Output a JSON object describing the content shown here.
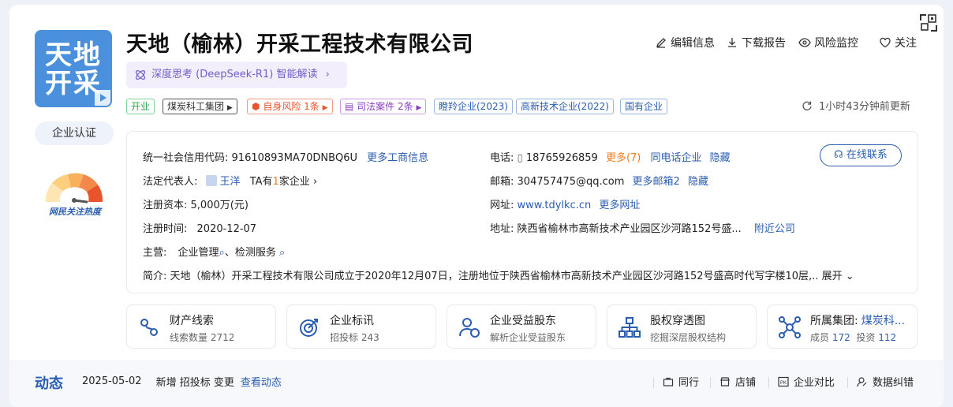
{
  "company": {
    "logo_line1": "天地",
    "logo_line2": "开采",
    "name": "天地（榆林）开采工程技术有限公司",
    "verify_label": "企业认证",
    "heat_label": "网民关注热度"
  },
  "ai": {
    "label": "深度思考 (DeepSeek-R1) 智能解读"
  },
  "actions": {
    "edit": "编辑信息",
    "download": "下载报告",
    "monitor": "风险监控",
    "follow": "关注"
  },
  "tags": [
    {
      "label": "开业"
    },
    {
      "label": "煤炭科工集团"
    },
    {
      "label": "自身风险 1条"
    },
    {
      "label": "司法案件 2条"
    },
    {
      "label": "瞪羚企业(2023)"
    },
    {
      "label": "高新技术企业(2022)"
    },
    {
      "label": "国有企业"
    }
  ],
  "update_text": "1小时43分钟前更新",
  "info": {
    "credit_label": "统一社会信用代码:",
    "credit_value": "91610893MA70DNBQ6U",
    "credit_more": "更多工商信息",
    "legal_label": "法定代表人:",
    "legal_name": "王洋",
    "legal_extra_pre": "TA有",
    "legal_extra_num": "1",
    "legal_extra_post": "家企业",
    "capital_label": "注册资本:",
    "capital_value": "5,000万(元)",
    "reg_time_label": "注册时间:",
    "reg_time_value": "2020-12-07",
    "business_label": "主营:",
    "business_1": "企业管理",
    "business_2": "检测服务",
    "phone_label": "电话:",
    "phone_value": "18765926859",
    "phone_more": "更多(7)",
    "phone_same": "同电话企业",
    "phone_hide": "隐藏",
    "email_label": "邮箱:",
    "email_value": "304757475@qq.com",
    "email_more": "更多邮箱2",
    "email_hide": "隐藏",
    "web_label": "网址:",
    "web_value": "www.tdylkc.cn",
    "web_more": "更多网址",
    "addr_label": "地址:",
    "addr_value": "陕西省榆林市高新技术产业园区沙河路152号盛...",
    "addr_near": "附近公司",
    "contact_btn": "在线联系",
    "intro_label": "简介:",
    "intro_value": "天地（榆林）开采工程技术有限公司成立于2020年12月07日，注册地位于陕西省榆林市高新技术产业园区沙河路152号盛高时代写字楼10层,..",
    "intro_expand": "展开"
  },
  "tiles": [
    {
      "title": "财产线索",
      "sub_label": "线索数量",
      "sub_value": "2712"
    },
    {
      "title": "企业标讯",
      "sub_label": "招投标",
      "sub_value": "243"
    },
    {
      "title": "企业受益股东",
      "sub_label": "解析企业受益股东",
      "sub_value": ""
    },
    {
      "title": "股权穿透图",
      "sub_label": "挖掘深层股权结构",
      "sub_value": ""
    },
    {
      "title_pre": "所属集团:",
      "title_link": "煤炭科...",
      "members_label": "成员",
      "members_value": "172",
      "invest_label": "投资",
      "invest_value": "112"
    }
  ],
  "bottom": {
    "title": "动态",
    "date": "2025-05-02",
    "events": "新增 招投标 变更",
    "view": "查看动态",
    "peer": "同行",
    "shop": "店铺",
    "compare": "企业对比",
    "correct": "数据纠错"
  },
  "colors": {
    "accent": "#2a5db0",
    "logo_bg": "#4a90dc",
    "orange": "#f07c1e"
  }
}
